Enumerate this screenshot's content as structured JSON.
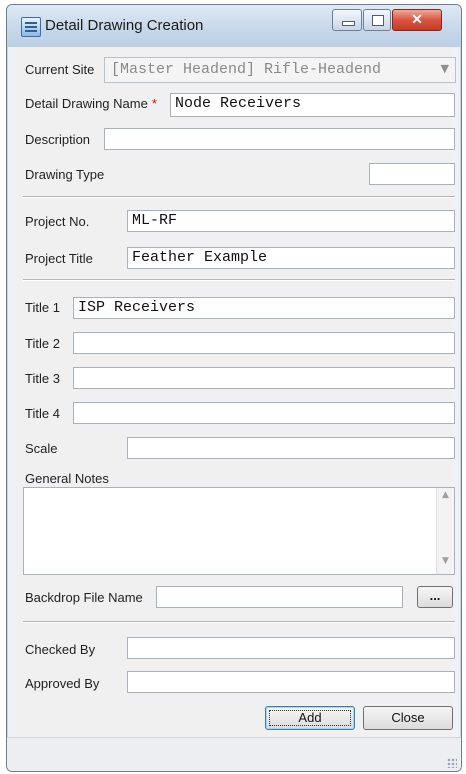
{
  "window": {
    "title": "Detail Drawing Creation"
  },
  "fields": {
    "current_site_label": "Current Site",
    "current_site_value": "[Master Headend] Rifle-Headend",
    "drawing_name_label": "Detail Drawing Name",
    "drawing_name_required": "*",
    "drawing_name_value": "Node Receivers",
    "description_label": "Description",
    "description_value": "",
    "drawing_type_label": "Drawing Type",
    "drawing_type_value": "",
    "project_no_label": "Project No.",
    "project_no_value": "ML-RF",
    "project_title_label": "Project Title",
    "project_title_value": "Feather Example",
    "title1_label": "Title 1",
    "title1_value": "ISP Receivers",
    "title2_label": "Title 2",
    "title2_value": "",
    "title3_label": "Title 3",
    "title3_value": "",
    "title4_label": "Title 4",
    "title4_value": "",
    "scale_label": "Scale",
    "scale_value": "",
    "general_notes_label": "General Notes",
    "general_notes_value": "",
    "backdrop_label": "Backdrop File Name",
    "backdrop_value": "",
    "browse_label": "...",
    "checked_by_label": "Checked By",
    "checked_by_value": "",
    "approved_by_label": "Approved By",
    "approved_by_value": ""
  },
  "buttons": {
    "add": "Add",
    "close": "Close"
  },
  "icons": {
    "app": "document-grid-icon",
    "minimize": "minimize-icon",
    "maximize": "maximize-icon",
    "close": "close-icon",
    "dropdown": "chevron-down-icon",
    "scroll_up": "scroll-up-icon",
    "scroll_down": "scroll-down-icon"
  },
  "colors": {
    "close_button": "#d8553f",
    "required_marker": "#d01010",
    "titlebar": "#c8d8ea"
  }
}
